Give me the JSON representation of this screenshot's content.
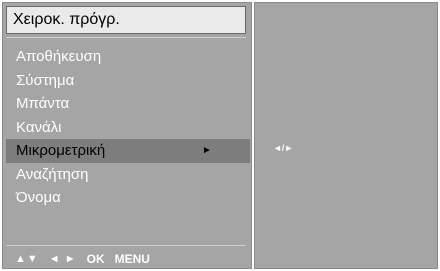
{
  "menu": {
    "title": "Χειροκ. πρόγρ.",
    "items": [
      {
        "label": "Αποθήκευση",
        "selected": false
      },
      {
        "label": "Σύστημα",
        "selected": false
      },
      {
        "label": "Μπάντα",
        "selected": false
      },
      {
        "label": "Κανάλι",
        "selected": false
      },
      {
        "label": "Μικρομετρική",
        "selected": true
      },
      {
        "label": "Αναζήτηση",
        "selected": false
      },
      {
        "label": "Όνομα",
        "selected": false
      }
    ],
    "selected_arrow": "►"
  },
  "nav_bar": {
    "up_down": "▲▼",
    "left_right": "◄ ►",
    "ok": "OK",
    "menu": "MENU"
  },
  "right_panel": {
    "indicator": "◄/►"
  },
  "colors": {
    "panel_bg": "#a5a5a5",
    "title_bg": "#eaeaea",
    "selected_bg": "#7d7d7d",
    "text": "#ffffff"
  }
}
